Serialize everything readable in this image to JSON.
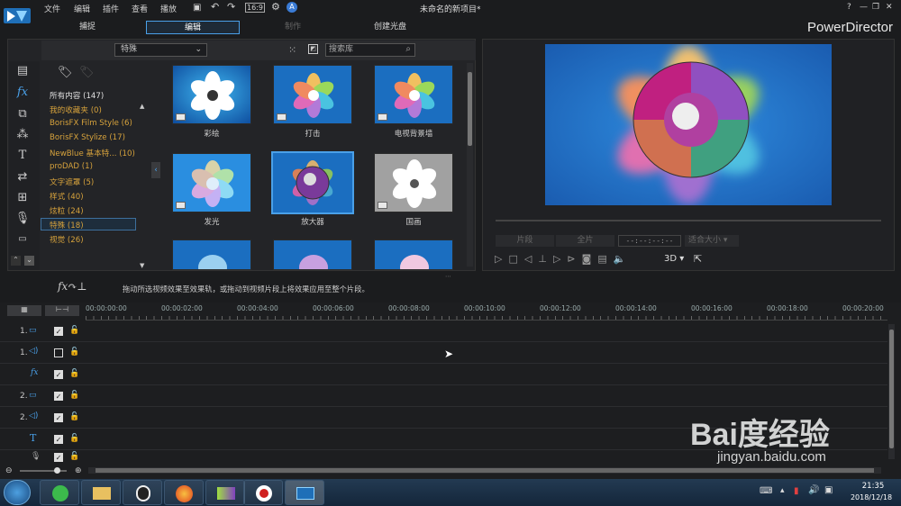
{
  "app": {
    "title": "未命名的新项目*",
    "brand": "PowerDirector"
  },
  "menu": [
    "文件",
    "编辑",
    "插件",
    "查看",
    "播放"
  ],
  "mode_tabs": [
    "捕捉",
    "编辑",
    "制作",
    "创建光盘"
  ],
  "library": {
    "dropdown": "特殊",
    "search_placeholder": "搜索库",
    "categories": [
      "所有内容 (147)",
      "我的收藏夹 (0)",
      "BorisFX Film Style (6)",
      "BorisFX Stylize (17)",
      "NewBlue 基本特... (10)",
      "proDAD (1)",
      "文字遮罩 (5)",
      "样式 (40)",
      "炫粒 (24)",
      "特殊 (18)",
      "视觉 (26)"
    ],
    "effects": [
      "彩绘",
      "打击",
      "电视背景墙",
      "发光",
      "放大器",
      "国画"
    ]
  },
  "preview": {
    "clip_btn": "片段",
    "movie_btn": "全片",
    "timecode": "--:--:--:--",
    "fit": "适合大小",
    "mode_3d": "3D"
  },
  "hint": "拖动所选视频效果至效果轨，或拖动到视频片段上将效果应用至整个片段。",
  "ruler": [
    "00:00:00:00",
    "00:00:02:00",
    "00:00:04:00",
    "00:00:06:00",
    "00:00:08:00",
    "00:00:10:00",
    "00:00:12:00",
    "00:00:14:00",
    "00:00:16:00",
    "00:00:18:00",
    "00:00:20:00"
  ],
  "tracks": [
    "1.",
    "1.",
    "fx",
    "2.",
    "2.",
    "T",
    ""
  ],
  "taskbar": {
    "time": "21:35",
    "date": "2018/12/18"
  },
  "watermark": {
    "brand": "Bai度经验",
    "url": "jingyan.baidu.com"
  }
}
